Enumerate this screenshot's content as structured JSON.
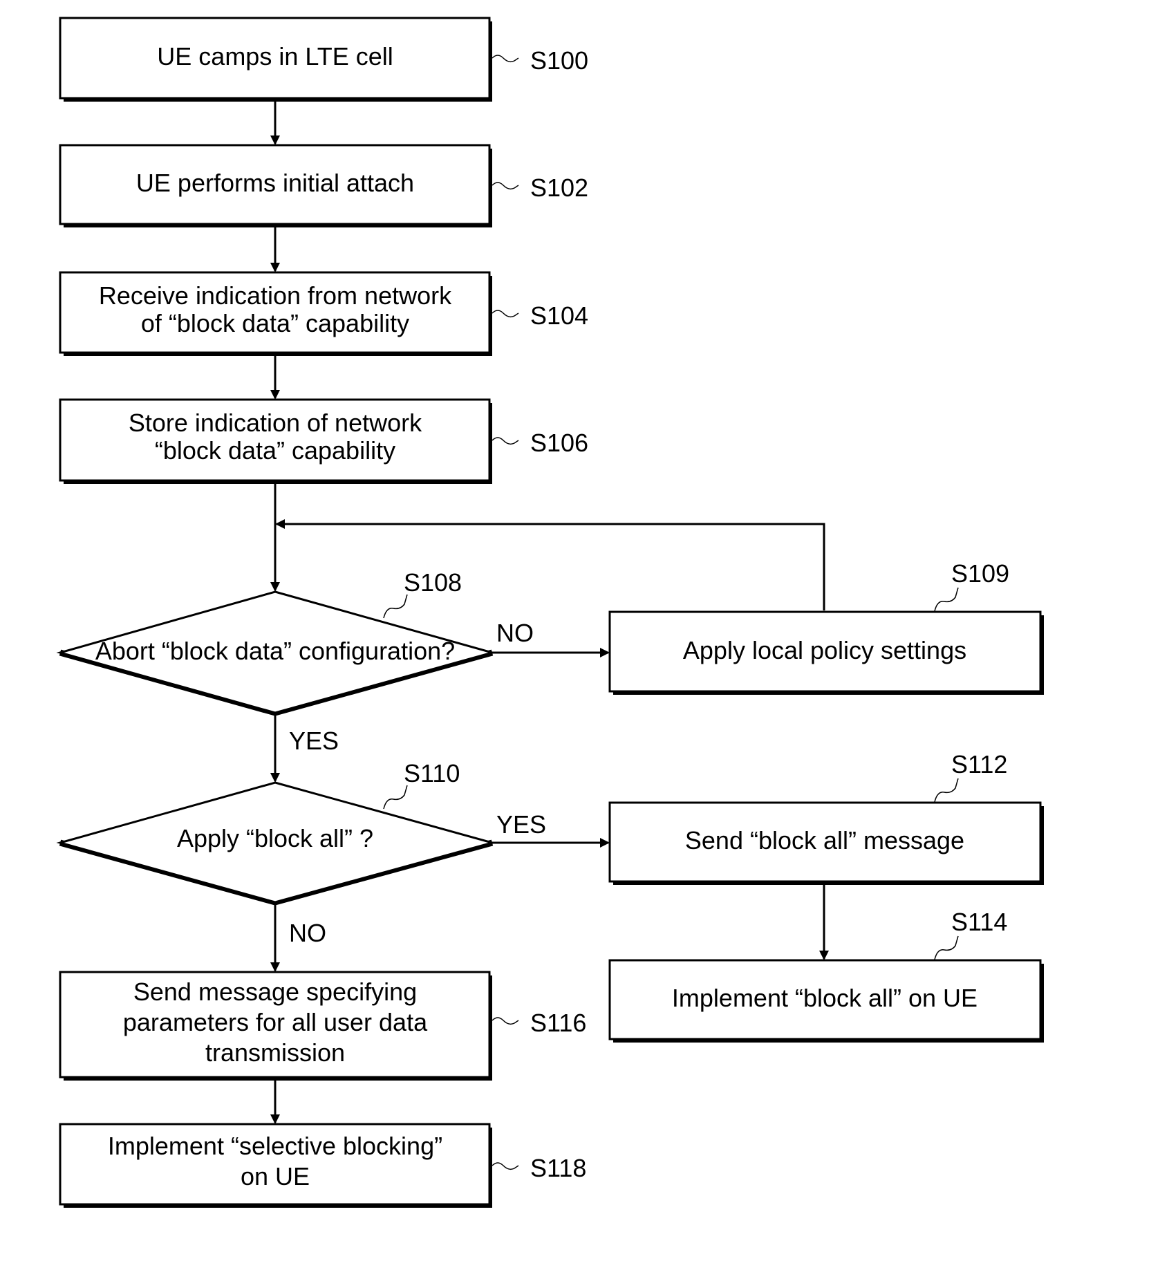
{
  "diagram": {
    "type": "flowchart",
    "nodes": [
      {
        "id": "S100",
        "kind": "process",
        "lines": [
          "UE camps in LTE cell"
        ]
      },
      {
        "id": "S102",
        "kind": "process",
        "lines": [
          "UE performs initial attach"
        ]
      },
      {
        "id": "S104",
        "kind": "process",
        "lines": [
          "Receive indication from network",
          "of “block data” capability"
        ]
      },
      {
        "id": "S106",
        "kind": "process",
        "lines": [
          "Store indication of network",
          "“block data” capability"
        ]
      },
      {
        "id": "S108",
        "kind": "decision",
        "lines": [
          "Abort “block data” configuration?"
        ]
      },
      {
        "id": "S109",
        "kind": "process",
        "lines": [
          "Apply local policy settings"
        ]
      },
      {
        "id": "S110",
        "kind": "decision",
        "lines": [
          "Apply “block all” ?"
        ]
      },
      {
        "id": "S112",
        "kind": "process",
        "lines": [
          "Send “block all” message"
        ]
      },
      {
        "id": "S114",
        "kind": "process",
        "lines": [
          "Implement “block all” on UE"
        ]
      },
      {
        "id": "S116",
        "kind": "process",
        "lines": [
          "Send message specifying",
          "parameters for all user data",
          "transmission"
        ]
      },
      {
        "id": "S118",
        "kind": "process",
        "lines": [
          "Implement “selective blocking”",
          "on UE"
        ]
      }
    ],
    "edges": [
      {
        "from": "S100",
        "to": "S102",
        "label": ""
      },
      {
        "from": "S102",
        "to": "S104",
        "label": ""
      },
      {
        "from": "S104",
        "to": "S106",
        "label": ""
      },
      {
        "from": "S106",
        "to": "S108",
        "label": ""
      },
      {
        "from": "S108",
        "to": "S109",
        "label": "NO"
      },
      {
        "from": "S109",
        "to": "S108",
        "label": ""
      },
      {
        "from": "S108",
        "to": "S110",
        "label": "YES"
      },
      {
        "from": "S110",
        "to": "S112",
        "label": "YES"
      },
      {
        "from": "S112",
        "to": "S114",
        "label": ""
      },
      {
        "from": "S110",
        "to": "S116",
        "label": "NO"
      },
      {
        "from": "S116",
        "to": "S118",
        "label": ""
      }
    ]
  },
  "labels": {
    "s108_no": "NO",
    "s108_yes": "YES",
    "s110_yes": "YES",
    "s110_no": "NO"
  },
  "step_ids": {
    "s100": "S100",
    "s102": "S102",
    "s104": "S104",
    "s106": "S106",
    "s108": "S108",
    "s109": "S109",
    "s110": "S110",
    "s112": "S112",
    "s114": "S114",
    "s116": "S116",
    "s118": "S118"
  }
}
